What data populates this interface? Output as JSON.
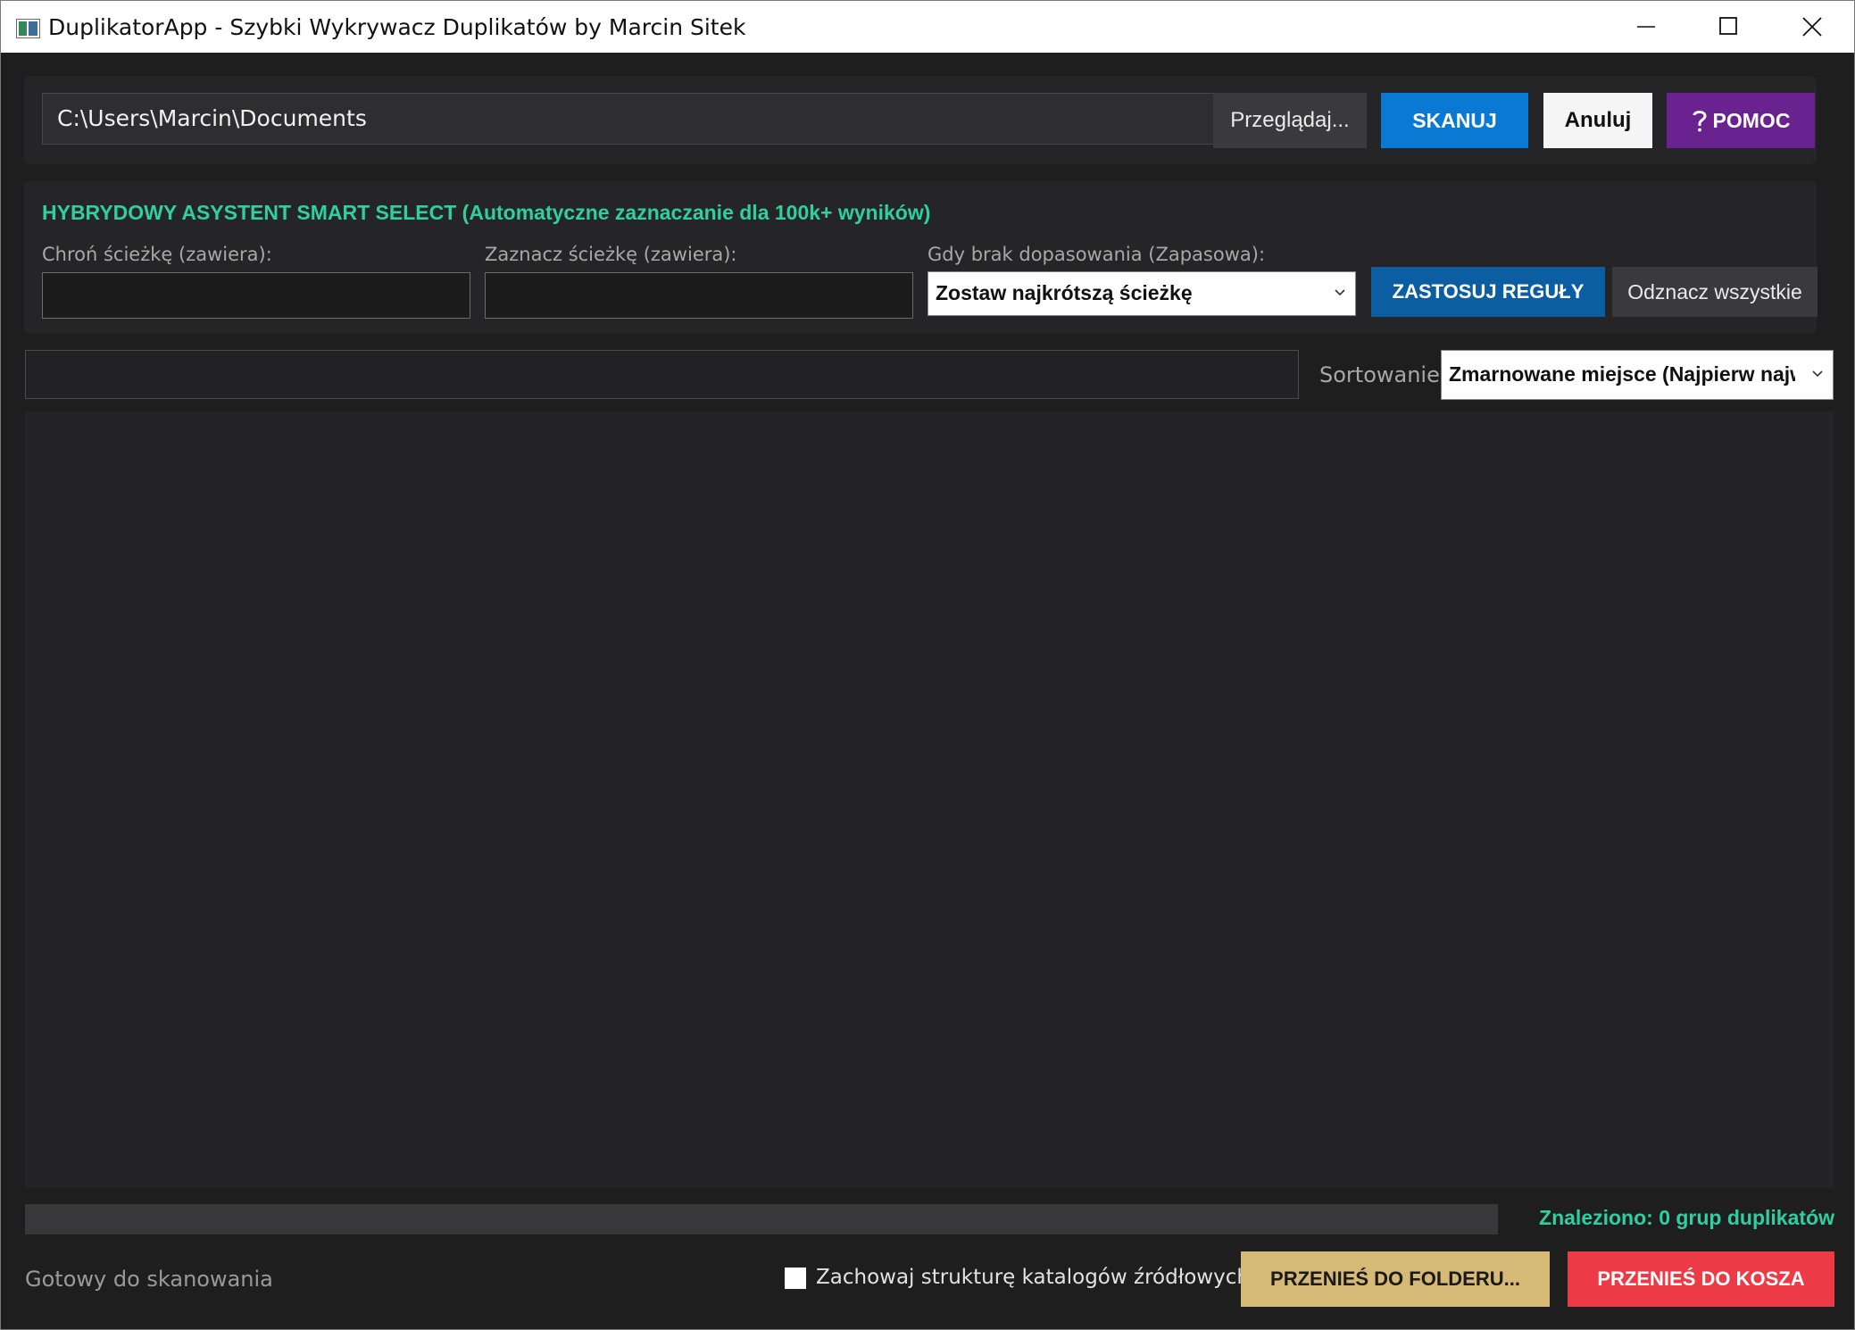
{
  "window": {
    "title": "DuplikatorApp - Szybki Wykrywacz Duplikatów by Marcin Sitek",
    "icon": "app-icon",
    "controls": [
      "minimize-icon",
      "maximize-icon",
      "close-icon"
    ]
  },
  "toolbar": {
    "path_value": "C:\\Users\\Marcin\\Documents",
    "browse_label": "Przeglądaj...",
    "scan_label": "SKANUJ",
    "cancel_label": "Anuluj",
    "help_label": "POMOC",
    "help_icon": "question-icon"
  },
  "smart_select": {
    "title": "HYBRYDOWY ASYSTENT SMART SELECT (Automatyczne zaznaczanie dla 100k+ wyników)",
    "protect_label": "Chroń ścieżkę (zawiera):",
    "protect_value": "",
    "mark_label": "Zaznacz ścieżkę (zawiera):",
    "mark_value": "",
    "fallback_label": "Gdy brak dopasowania (Zapasowa):",
    "fallback_value": "Zostaw najkrótszą ścieżkę",
    "apply_label": "ZASTOSUJ REGUŁY",
    "unmark_label": "Odznacz wszystkie"
  },
  "filter": {
    "value": "",
    "sort_label": "Sortowanie:",
    "sort_value": "Zmarnowane miejsce (Najpierw największe)"
  },
  "results": {
    "rows": []
  },
  "footer": {
    "progress_value": 0,
    "found_text": "Znaleziono: 0 grup duplikatów",
    "status_text": "Gotowy do skanowania",
    "keep_structure_label": "Zachowaj strukturę katalogów źródłowych",
    "keep_structure_checked": false,
    "move_folder_label": "PRZENIEŚ DO FOLDERU...",
    "move_trash_label": "PRZENIEŚ DO KOSZA"
  },
  "colors": {
    "accent_green": "#2fcf9f",
    "scan_blue": "#0a79d4",
    "apply_blue": "#0c5ea3",
    "help_purple": "#6a2291",
    "folder_gold": "#d6b877",
    "trash_red": "#ec3b46"
  }
}
